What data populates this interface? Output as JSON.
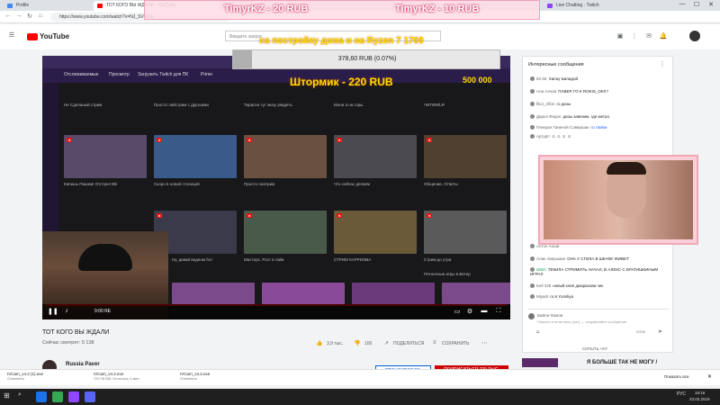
{
  "browser": {
    "tabs": [
      {
        "label": "Profile",
        "color": "#4285f4"
      },
      {
        "label": "ТОТ КОГО ВЫ ЖДАЛИ - YouTube",
        "color": "#ff0000"
      },
      {
        "label": "Live Chatting · Twitch",
        "color": "#9146ff"
      }
    ],
    "url": "https://www.youtube.com/watch?v=NJ_SVRkGj",
    "win_min": "—",
    "win_max": "☐",
    "win_close": "✕"
  },
  "youtube": {
    "logo": "YouTube",
    "search_placeholder": "Введите запрос",
    "video_title": "ТОТ КОГО ВЫ ЖДАЛИ",
    "viewers": "Сейчас смотрят: 5 138",
    "likes": "3,9 тыс.",
    "dislikes": "100",
    "share": "ПОДЕЛИТЬСЯ",
    "save": "СОХРАНИТЬ",
    "channel": "Russia Paver",
    "sponsor_btn": "СПОНСИРОВАТЬ",
    "subscribe_btn": "ПОДПИСАТЬСЯ 779 ТЫС.",
    "time": "9:00 RE"
  },
  "overlay": {
    "donor1": "TimyrKZ - 20 RUB",
    "donor2": "TimyrKZ - 10 RUB",
    "message": "на постройку дома и на Ryzen 7 1700",
    "goal_text": "378,60 RUB (0.07%)",
    "goal_fraction": 0.0007,
    "latest_donor": "Штормик - 220 RUB",
    "goal_target": "500 000"
  },
  "chat": {
    "header": "Интересные сообщения",
    "messages": [
      {
        "name": "84 5K",
        "text": "Хапоу маладой"
      },
      {
        "name": "Ала Алчая",
        "text": "ПАВЕР, ГО К ROKIS_OKI!?"
      },
      {
        "name": "fikiJ_Alfon",
        "text": "го дизы"
      },
      {
        "name": "Дарья Федоп",
        "text": "дизы завезим, где метро"
      },
      {
        "name": "Генерал Ганеной Совершан",
        "text": "го Лайки"
      },
      {
        "name": "Артур!!",
        "text": "☺ ☺ ☺ ☺"
      },
      {
        "name": "Антон Аоши",
        "text": ""
      },
      {
        "name": "Алик Аверьман",
        "text": "ОНА У СТИЛА В ШКАФУ ЖИВЕТ"
      },
      {
        "name": "s6tch",
        "text": "ТЕКИЛА СТРИМИТЬ НАЧАЛ, В АЛЕКС С БРАТИШКИНЫМ ИГРАЛ"
      },
      {
        "name": "Keil 228",
        "text": "новый клип джарахова чек"
      },
      {
        "name": "Miyarti",
        "text": "го в Yumiliya"
      }
    ],
    "input_name": "Бийли Фомов",
    "input_placeholder": "Пишите в этом поле (чат) — отправляйте сообщение",
    "counter": "0/200",
    "hide_chat": "СКРЫТЬ ЧАТ",
    "below_text": "Я БОЛЬШЕ ТАК НЕ МОГУ /"
  },
  "downloads": [
    {
      "name": "IVCam_v4.2 (1).exe",
      "sub": "Отменено"
    },
    {
      "name": "IVCam_v4.2.exe",
      "sub": "7/9,7/8 Мб, Осталось 4 мин."
    },
    {
      "name": "IVCam_v4.2.exe",
      "sub": "Отменено"
    }
  ],
  "downloads_all": "Показать все",
  "taskbar": {
    "lang": "РУС",
    "time": "19:16",
    "date": "23.02.2019"
  },
  "twitch_nav": [
    "Отслеживаемые",
    "Просмотр",
    "Загрузить Twitch для ПК",
    "Prime"
  ],
  "twitch_captions": [
    "Не Сделаный стрим",
    "Просто лайстрим с друзьями",
    "Тирасно тут жизу увидеть",
    "Мони а на горы",
    "ЧИТИМ/LR",
    "Кипишь Пишем! Отстрел ВБ",
    "Скоро в новой столицей",
    "Просто смотрим",
    "Что сейчас делаем",
    "Общение, Ответы",
    "Ну, давай видеом бот",
    "Мастерс. Рост в лайк",
    "СТРИМ КАРРИЗМА",
    "Стрим до утра",
    "Пятничные игры в Ветер"
  ],
  "colors": {
    "yt_red": "#ff0000",
    "twitch_purple": "#9146ff",
    "overlay_pink": "#f3a0b8",
    "overlay_yellow": "#ffd900"
  }
}
